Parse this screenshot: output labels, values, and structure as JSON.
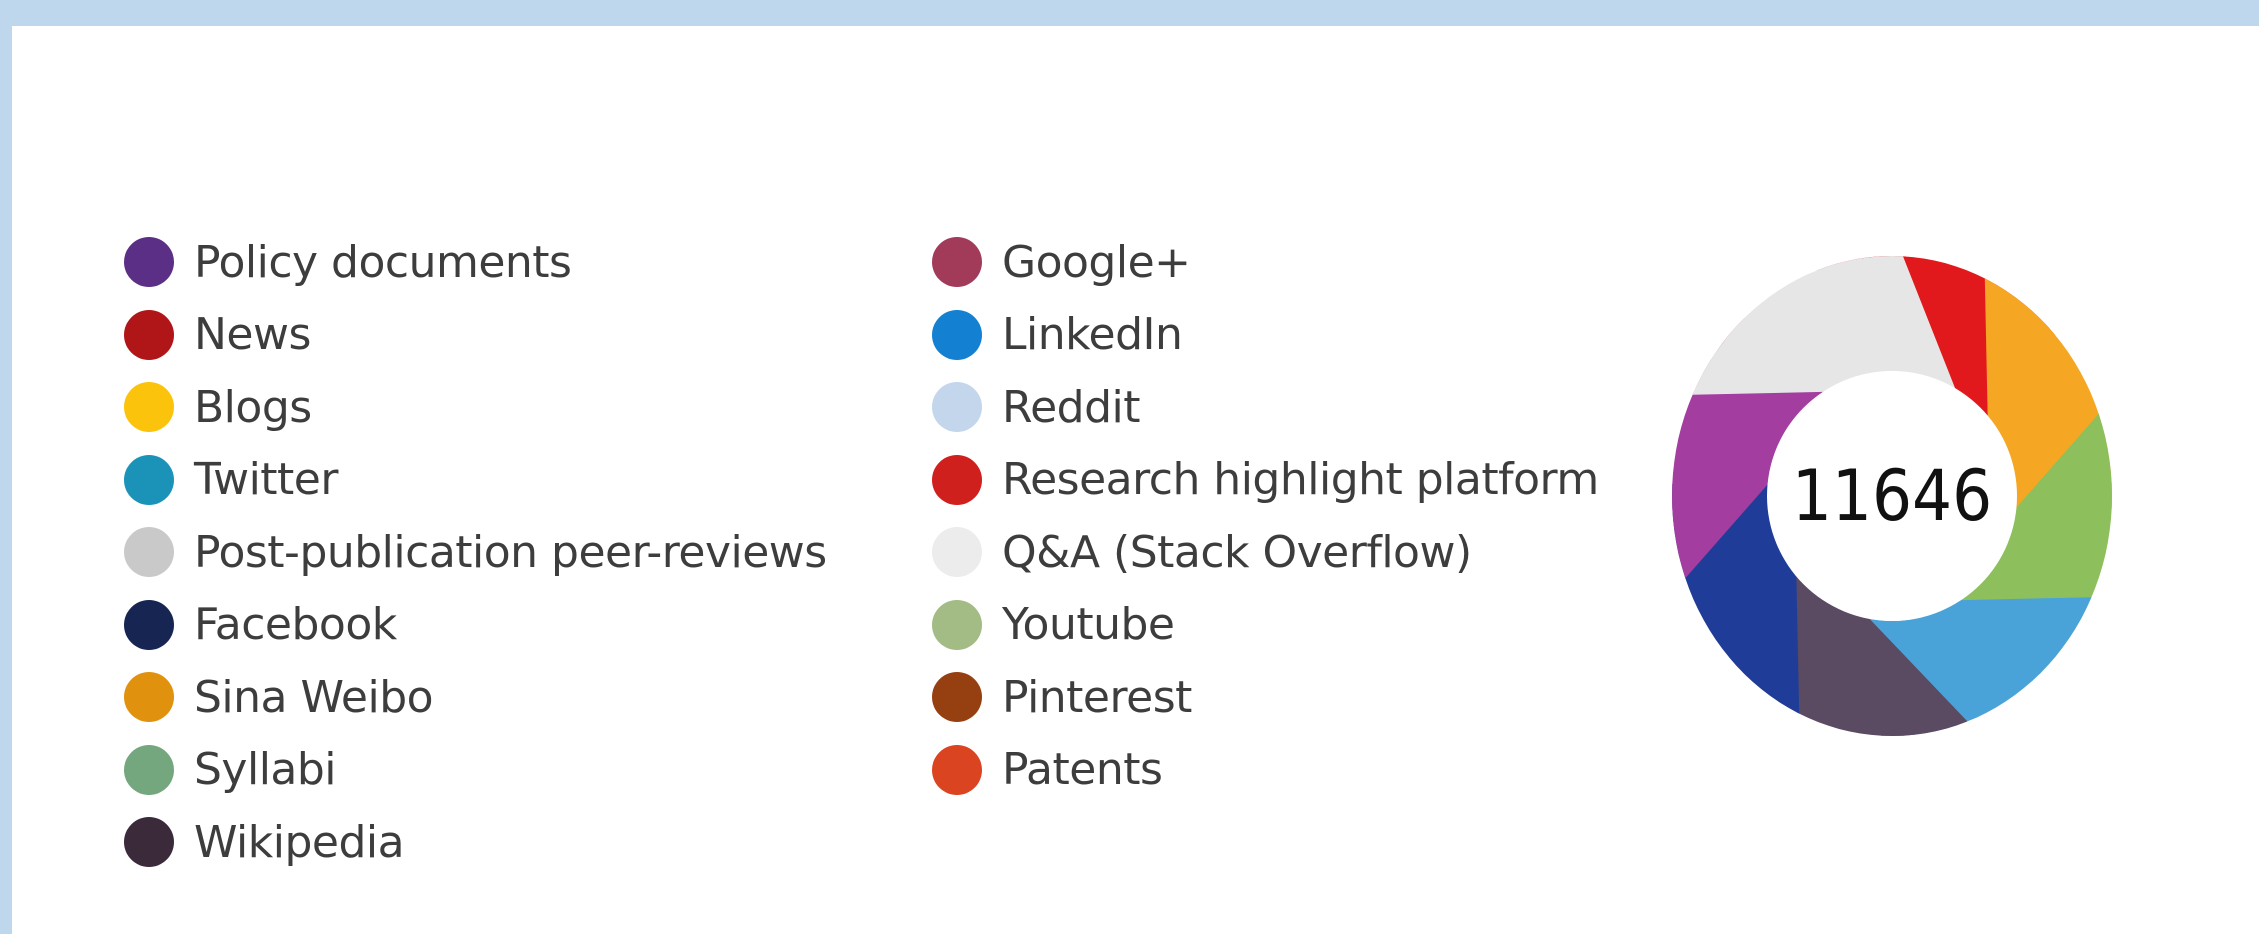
{
  "chart_data": {
    "type": "donut",
    "score": "11646",
    "legend": [
      {
        "label": "Policy documents",
        "color": "#5b2f85"
      },
      {
        "label": "News",
        "color": "#b01517"
      },
      {
        "label": "Blogs",
        "color": "#fcc30c"
      },
      {
        "label": "Twitter",
        "color": "#1b93b9"
      },
      {
        "label": "Post-publication peer-reviews",
        "color": "#c9c9c9"
      },
      {
        "label": "Facebook",
        "color": "#172553"
      },
      {
        "label": "Sina Weibo",
        "color": "#e0920f"
      },
      {
        "label": "Syllabi",
        "color": "#74a77e"
      },
      {
        "label": "Wikipedia",
        "color": "#3b2a3a"
      },
      {
        "label": "Google+",
        "color": "#a23a5a"
      },
      {
        "label": "LinkedIn",
        "color": "#1380d2"
      },
      {
        "label": "Reddit",
        "color": "#c3d6ec"
      },
      {
        "label": "Research highlight platform",
        "color": "#d0201e"
      },
      {
        "label": "Q&A (Stack Overflow)",
        "color": "#ececec"
      },
      {
        "label": "Youtube",
        "color": "#a3bb84"
      },
      {
        "label": "Pinterest",
        "color": "#964012"
      },
      {
        "label": "Patents",
        "color": "#da4420"
      }
    ],
    "ring": [
      {
        "color": "#e2191c",
        "share": 1
      },
      {
        "color": "#f5a623",
        "share": 1
      },
      {
        "color": "#8dc05d",
        "share": 1
      },
      {
        "color": "#4aa3d8",
        "share": 1
      },
      {
        "color": "#5a4a62",
        "share": 1
      },
      {
        "color": "#1f3d98",
        "share": 1
      },
      {
        "color": "#a33ea0",
        "share": 1
      },
      {
        "color": "#e6e6e6",
        "share": 1
      }
    ]
  }
}
